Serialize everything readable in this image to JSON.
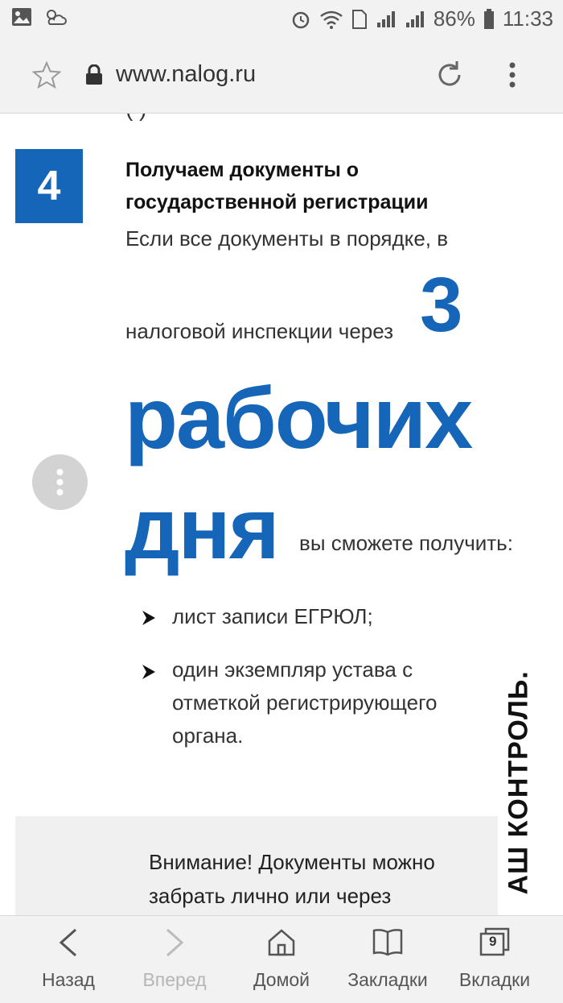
{
  "status_bar": {
    "battery": "86%",
    "time": "11:33",
    "icons": [
      "image-icon",
      "weather-icon",
      "alarm-icon",
      "wifi-icon",
      "sim-icon",
      "signal-icon",
      "signal-icon",
      "battery-icon"
    ]
  },
  "browser": {
    "url": "www.nalog.ru"
  },
  "content": {
    "cut_text": "(          )                                  ",
    "step_number": "4",
    "step_title": "Получаем документы о государственной регистрации",
    "body_line1": "Если все документы в порядке, в",
    "body_line2": "налоговой инспекции через",
    "big_number": "3",
    "big_word1": "рабочих",
    "big_word2": "дня",
    "body_line3": "вы сможете получить:",
    "bullets": [
      "лист записи ЕГРЮЛ;",
      "один экземпляр устава с отметкой регистрирующего органа."
    ],
    "notice": "Внимание! Документы можно забрать лично или через",
    "watermark": "АШ КОНТРОЛЬ."
  },
  "bottom_nav": {
    "back": "Назад",
    "forward": "Вперед",
    "home": "Домой",
    "bookmarks": "Закладки",
    "tabs": "Вкладки",
    "tabs_count": "9"
  },
  "colors": {
    "accent": "#1565b8",
    "bar_bg": "#f2f2f2"
  }
}
